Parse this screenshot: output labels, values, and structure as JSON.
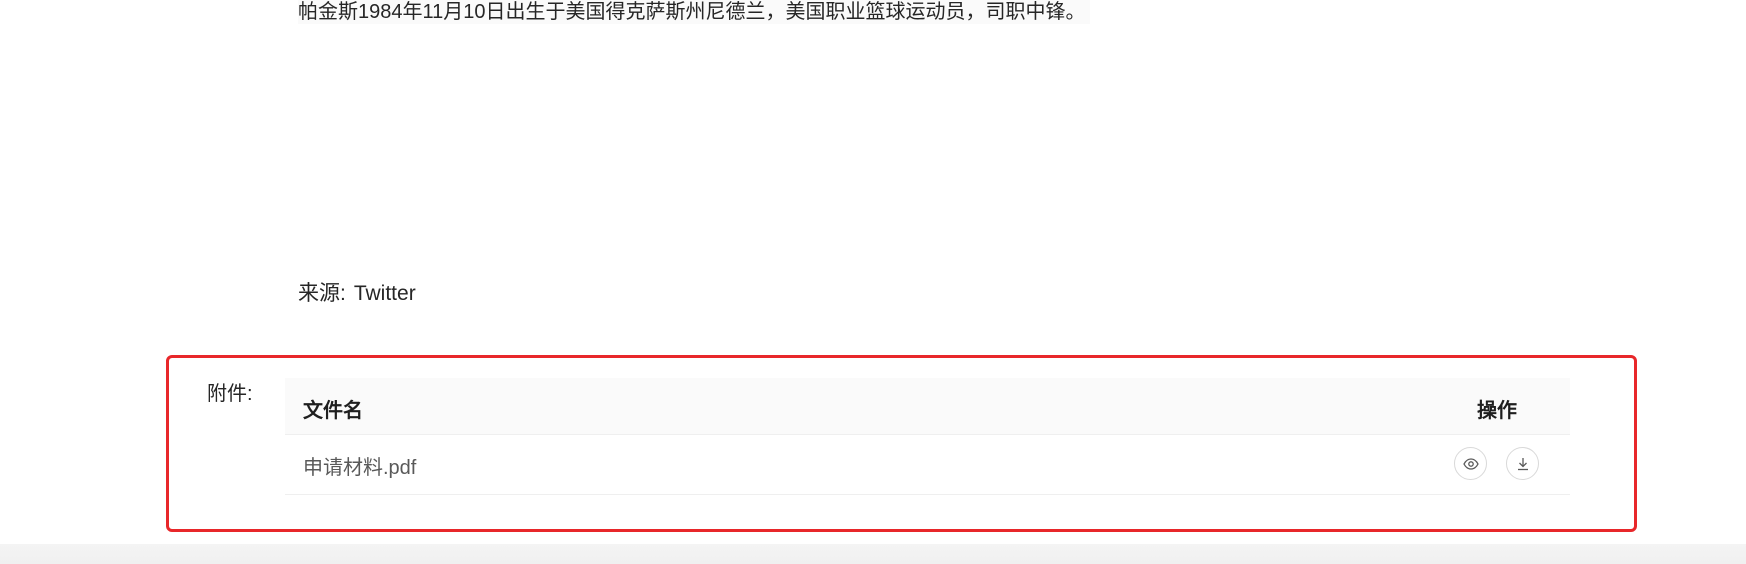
{
  "article": {
    "body_text": "帕金斯1984年11月10日出生于美国得克萨斯州尼德兰，美国职业篮球运动员，司职中锋。",
    "source_label": "来源:",
    "source_value": "Twitter"
  },
  "attachments": {
    "label": "附件:",
    "columns": {
      "name": "文件名",
      "action": "操作"
    },
    "files": [
      {
        "name": "申请材料.pdf",
        "actions": [
          "eye-icon",
          "download-icon"
        ]
      }
    ]
  },
  "colors": {
    "highlight_border": "#e8272a",
    "table_header_bg": "#fafafa",
    "text_primary": "#262626",
    "text_secondary": "#595959"
  }
}
